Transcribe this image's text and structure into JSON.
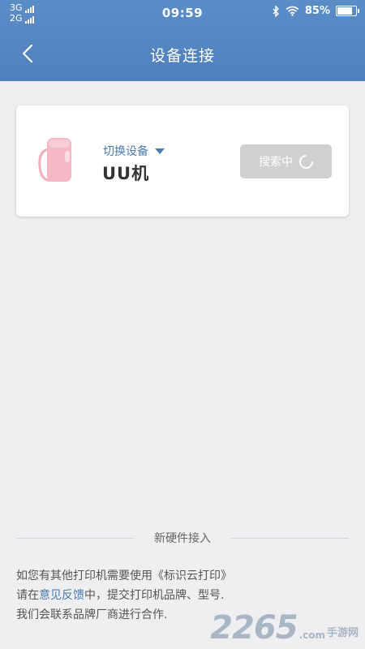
{
  "status_bar": {
    "net1": "3G",
    "net2": "2G",
    "time": "09:59",
    "battery_level": 85,
    "battery": "85%"
  },
  "header": {
    "title": "设备连接"
  },
  "device_card": {
    "switch_label": "切换设备",
    "device_name": "UU机",
    "search_button": "搜索中"
  },
  "footer": {
    "divider": "新硬件接入",
    "line1": "如您有其他打印机需要使用《标识云打印》",
    "line2_pre": "请在",
    "line2_link": "意见反馈",
    "line2_post": "中，提交打印机品牌、型号.",
    "line3": "我们会联系品牌厂商进行合作."
  },
  "watermark": {
    "number": "2265",
    "suffix": ".com",
    "site": "手游网"
  },
  "colors": {
    "header": "#5b8dc7",
    "accent": "#4a7ab0",
    "printer": "#f4b9c2"
  }
}
